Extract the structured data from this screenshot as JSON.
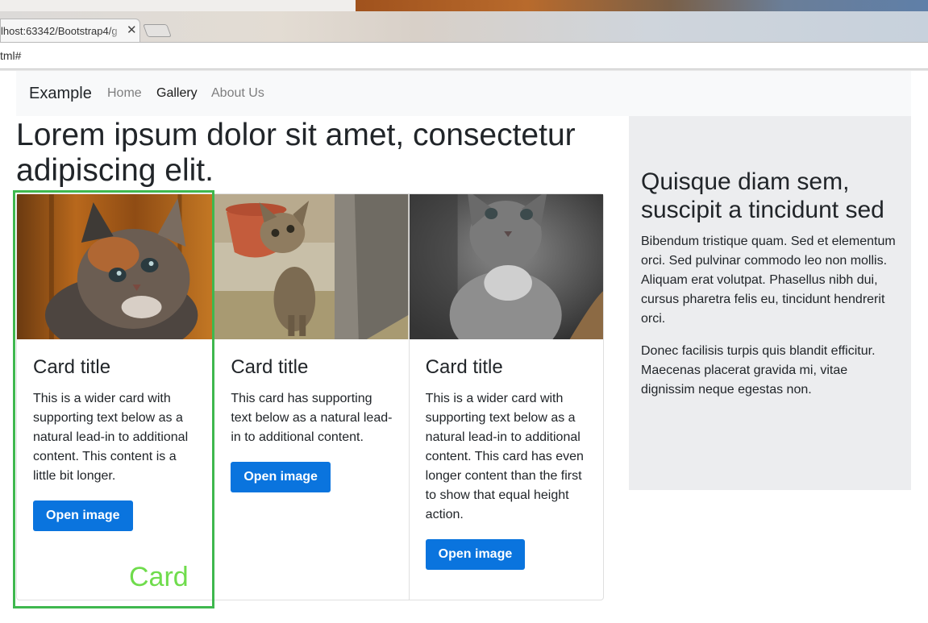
{
  "browser": {
    "tab_title": "lhost:63342/Bootstrap4/g",
    "tab_close": "✕",
    "address": "tml#"
  },
  "navbar": {
    "brand": "Example",
    "links": [
      "Home",
      "Gallery",
      "About Us"
    ],
    "active_index": 1
  },
  "main": {
    "heading": "Lorem ipsum dolor sit amet, consectetur adipiscing elit."
  },
  "cards": [
    {
      "title": "Card title",
      "text": "This is a wider card with supporting text below as a natural lead-in to additional content. This content is a little bit longer.",
      "button": "Open image",
      "image": "kitten-calico-photo"
    },
    {
      "title": "Card title",
      "text": "This card has supporting text below as a natural lead-in to additional content.",
      "button": "Open image",
      "image": "kitten-tabby-flowerpot-photo"
    },
    {
      "title": "Card title",
      "text": "This is a wider card with supporting text below as a natural lead-in to additional content. This card has even longer content than the first to show that equal height action.",
      "button": "Open image",
      "image": "kitten-grey-tabby-photo"
    }
  ],
  "annotation": {
    "label": "Card",
    "color": "#3fb84e"
  },
  "aside": {
    "title": "Quisque diam sem, suscipit a tincidunt sed",
    "paragraphs": [
      "Bibendum tristique quam. Sed et elementum orci. Sed pulvinar commodo leo non mollis. Aliquam erat volutpat. Phasellus nibh dui, cursus pharetra felis eu, tincidunt hendrerit orci.",
      "Donec facilisis turpis quis blandit efficitur. Maecenas placerat gravida mi, vitae dignissim neque egestas non."
    ]
  },
  "colors": {
    "primary_button": "#0a74de",
    "navbar_bg": "#f8f9fa",
    "aside_bg": "#ecedef"
  }
}
